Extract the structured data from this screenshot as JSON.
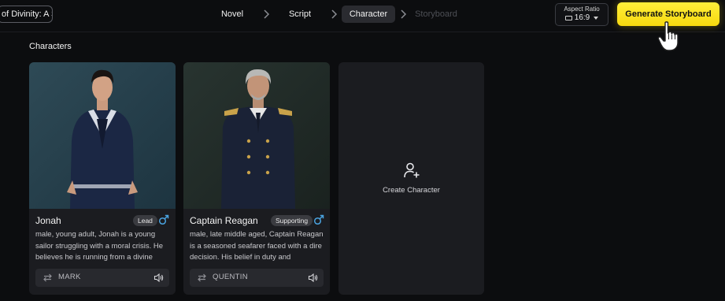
{
  "header": {
    "project_title": "of Divinity: A Sto",
    "steps": [
      {
        "label": "Novel",
        "state": "done"
      },
      {
        "label": "Script",
        "state": "done"
      },
      {
        "label": "Character",
        "state": "active"
      },
      {
        "label": "Storyboard",
        "state": "disabled"
      }
    ],
    "aspect_ratio": {
      "label": "Aspect Ratio",
      "value": "16:9",
      "icon": "ratio-icon"
    },
    "generate_button": "Generate Storyboard"
  },
  "section": {
    "title": "Characters"
  },
  "characters": [
    {
      "name": "Jonah",
      "role": "Lead",
      "gender_icon": "male-icon",
      "description": "male, young adult, Jonah is a young sailor struggling with a moral crisis. He believes he is running from a divine",
      "voice": "MARK"
    },
    {
      "name": "Captain Reagan",
      "role": "Supporting",
      "gender_icon": "male-icon",
      "description": "male, late middle aged, Captain Reagan is a seasoned seafarer faced with a dire decision. His belief in duty and",
      "voice": "QUENTIN"
    }
  ],
  "create_card": {
    "label": "Create Character",
    "icon": "add-user-icon"
  },
  "colors": {
    "background": "#0c0d0f",
    "card": "#1b1c20",
    "accent_yellow": "#f7d90f",
    "male_icon": "#4aa3e0"
  }
}
